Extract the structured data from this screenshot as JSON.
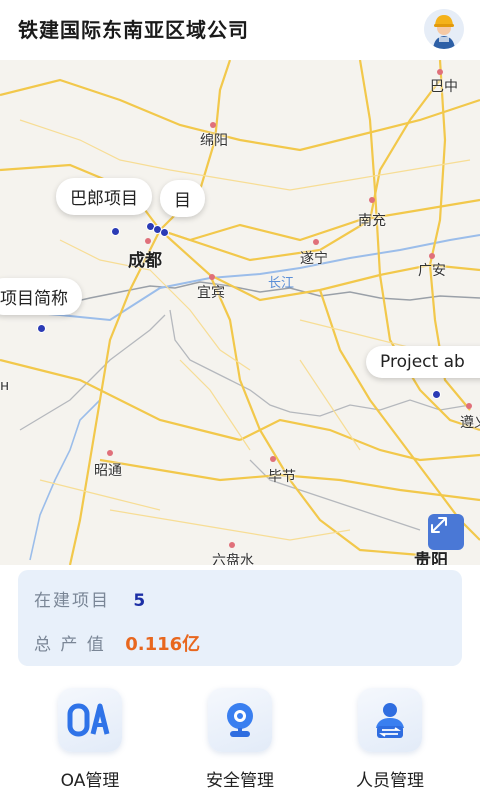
{
  "header": {
    "title": "铁建国际东南亚区域公司"
  },
  "map": {
    "cities": [
      "巴中",
      "绵阳",
      "南充",
      "成都",
      "遂宁",
      "广安",
      "宜宾",
      "遵义",
      "昭通",
      "毕节",
      "六盘水",
      "贵阳"
    ],
    "river_label": "长江",
    "project_bubbles": [
      "巴郎项目",
      "目",
      "项目简称",
      "Project ab"
    ],
    "edge_glyph": "н",
    "expand_icon": "expand-icon"
  },
  "stats": {
    "projects_label": "在建项目",
    "projects_value": "5",
    "output_label": "总 产 值",
    "output_value": "0.116亿"
  },
  "nav": [
    {
      "label": "OA管理",
      "icon": "oa-icon"
    },
    {
      "label": "安全管理",
      "icon": "camera-icon"
    },
    {
      "label": "人员管理",
      "icon": "person-icon"
    }
  ],
  "colors": {
    "accent_blue": "#1c2fa6",
    "value_orange": "#e8671e",
    "stats_bg": "#e8f0fa"
  }
}
